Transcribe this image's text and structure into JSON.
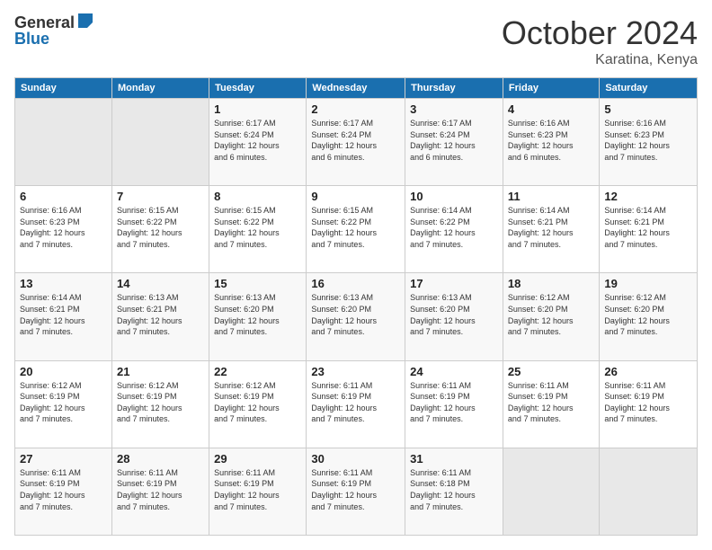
{
  "header": {
    "logo_general": "General",
    "logo_blue": "Blue",
    "month": "October 2024",
    "location": "Karatina, Kenya"
  },
  "days_of_week": [
    "Sunday",
    "Monday",
    "Tuesday",
    "Wednesday",
    "Thursday",
    "Friday",
    "Saturday"
  ],
  "weeks": [
    [
      {
        "day": "",
        "info": ""
      },
      {
        "day": "",
        "info": ""
      },
      {
        "day": "1",
        "info": "Sunrise: 6:17 AM\nSunset: 6:24 PM\nDaylight: 12 hours\nand 6 minutes."
      },
      {
        "day": "2",
        "info": "Sunrise: 6:17 AM\nSunset: 6:24 PM\nDaylight: 12 hours\nand 6 minutes."
      },
      {
        "day": "3",
        "info": "Sunrise: 6:17 AM\nSunset: 6:24 PM\nDaylight: 12 hours\nand 6 minutes."
      },
      {
        "day": "4",
        "info": "Sunrise: 6:16 AM\nSunset: 6:23 PM\nDaylight: 12 hours\nand 6 minutes."
      },
      {
        "day": "5",
        "info": "Sunrise: 6:16 AM\nSunset: 6:23 PM\nDaylight: 12 hours\nand 7 minutes."
      }
    ],
    [
      {
        "day": "6",
        "info": "Sunrise: 6:16 AM\nSunset: 6:23 PM\nDaylight: 12 hours\nand 7 minutes."
      },
      {
        "day": "7",
        "info": "Sunrise: 6:15 AM\nSunset: 6:22 PM\nDaylight: 12 hours\nand 7 minutes."
      },
      {
        "day": "8",
        "info": "Sunrise: 6:15 AM\nSunset: 6:22 PM\nDaylight: 12 hours\nand 7 minutes."
      },
      {
        "day": "9",
        "info": "Sunrise: 6:15 AM\nSunset: 6:22 PM\nDaylight: 12 hours\nand 7 minutes."
      },
      {
        "day": "10",
        "info": "Sunrise: 6:14 AM\nSunset: 6:22 PM\nDaylight: 12 hours\nand 7 minutes."
      },
      {
        "day": "11",
        "info": "Sunrise: 6:14 AM\nSunset: 6:21 PM\nDaylight: 12 hours\nand 7 minutes."
      },
      {
        "day": "12",
        "info": "Sunrise: 6:14 AM\nSunset: 6:21 PM\nDaylight: 12 hours\nand 7 minutes."
      }
    ],
    [
      {
        "day": "13",
        "info": "Sunrise: 6:14 AM\nSunset: 6:21 PM\nDaylight: 12 hours\nand 7 minutes."
      },
      {
        "day": "14",
        "info": "Sunrise: 6:13 AM\nSunset: 6:21 PM\nDaylight: 12 hours\nand 7 minutes."
      },
      {
        "day": "15",
        "info": "Sunrise: 6:13 AM\nSunset: 6:20 PM\nDaylight: 12 hours\nand 7 minutes."
      },
      {
        "day": "16",
        "info": "Sunrise: 6:13 AM\nSunset: 6:20 PM\nDaylight: 12 hours\nand 7 minutes."
      },
      {
        "day": "17",
        "info": "Sunrise: 6:13 AM\nSunset: 6:20 PM\nDaylight: 12 hours\nand 7 minutes."
      },
      {
        "day": "18",
        "info": "Sunrise: 6:12 AM\nSunset: 6:20 PM\nDaylight: 12 hours\nand 7 minutes."
      },
      {
        "day": "19",
        "info": "Sunrise: 6:12 AM\nSunset: 6:20 PM\nDaylight: 12 hours\nand 7 minutes."
      }
    ],
    [
      {
        "day": "20",
        "info": "Sunrise: 6:12 AM\nSunset: 6:19 PM\nDaylight: 12 hours\nand 7 minutes."
      },
      {
        "day": "21",
        "info": "Sunrise: 6:12 AM\nSunset: 6:19 PM\nDaylight: 12 hours\nand 7 minutes."
      },
      {
        "day": "22",
        "info": "Sunrise: 6:12 AM\nSunset: 6:19 PM\nDaylight: 12 hours\nand 7 minutes."
      },
      {
        "day": "23",
        "info": "Sunrise: 6:11 AM\nSunset: 6:19 PM\nDaylight: 12 hours\nand 7 minutes."
      },
      {
        "day": "24",
        "info": "Sunrise: 6:11 AM\nSunset: 6:19 PM\nDaylight: 12 hours\nand 7 minutes."
      },
      {
        "day": "25",
        "info": "Sunrise: 6:11 AM\nSunset: 6:19 PM\nDaylight: 12 hours\nand 7 minutes."
      },
      {
        "day": "26",
        "info": "Sunrise: 6:11 AM\nSunset: 6:19 PM\nDaylight: 12 hours\nand 7 minutes."
      }
    ],
    [
      {
        "day": "27",
        "info": "Sunrise: 6:11 AM\nSunset: 6:19 PM\nDaylight: 12 hours\nand 7 minutes."
      },
      {
        "day": "28",
        "info": "Sunrise: 6:11 AM\nSunset: 6:19 PM\nDaylight: 12 hours\nand 7 minutes."
      },
      {
        "day": "29",
        "info": "Sunrise: 6:11 AM\nSunset: 6:19 PM\nDaylight: 12 hours\nand 7 minutes."
      },
      {
        "day": "30",
        "info": "Sunrise: 6:11 AM\nSunset: 6:19 PM\nDaylight: 12 hours\nand 7 minutes."
      },
      {
        "day": "31",
        "info": "Sunrise: 6:11 AM\nSunset: 6:18 PM\nDaylight: 12 hours\nand 7 minutes."
      },
      {
        "day": "",
        "info": ""
      },
      {
        "day": "",
        "info": ""
      }
    ]
  ]
}
